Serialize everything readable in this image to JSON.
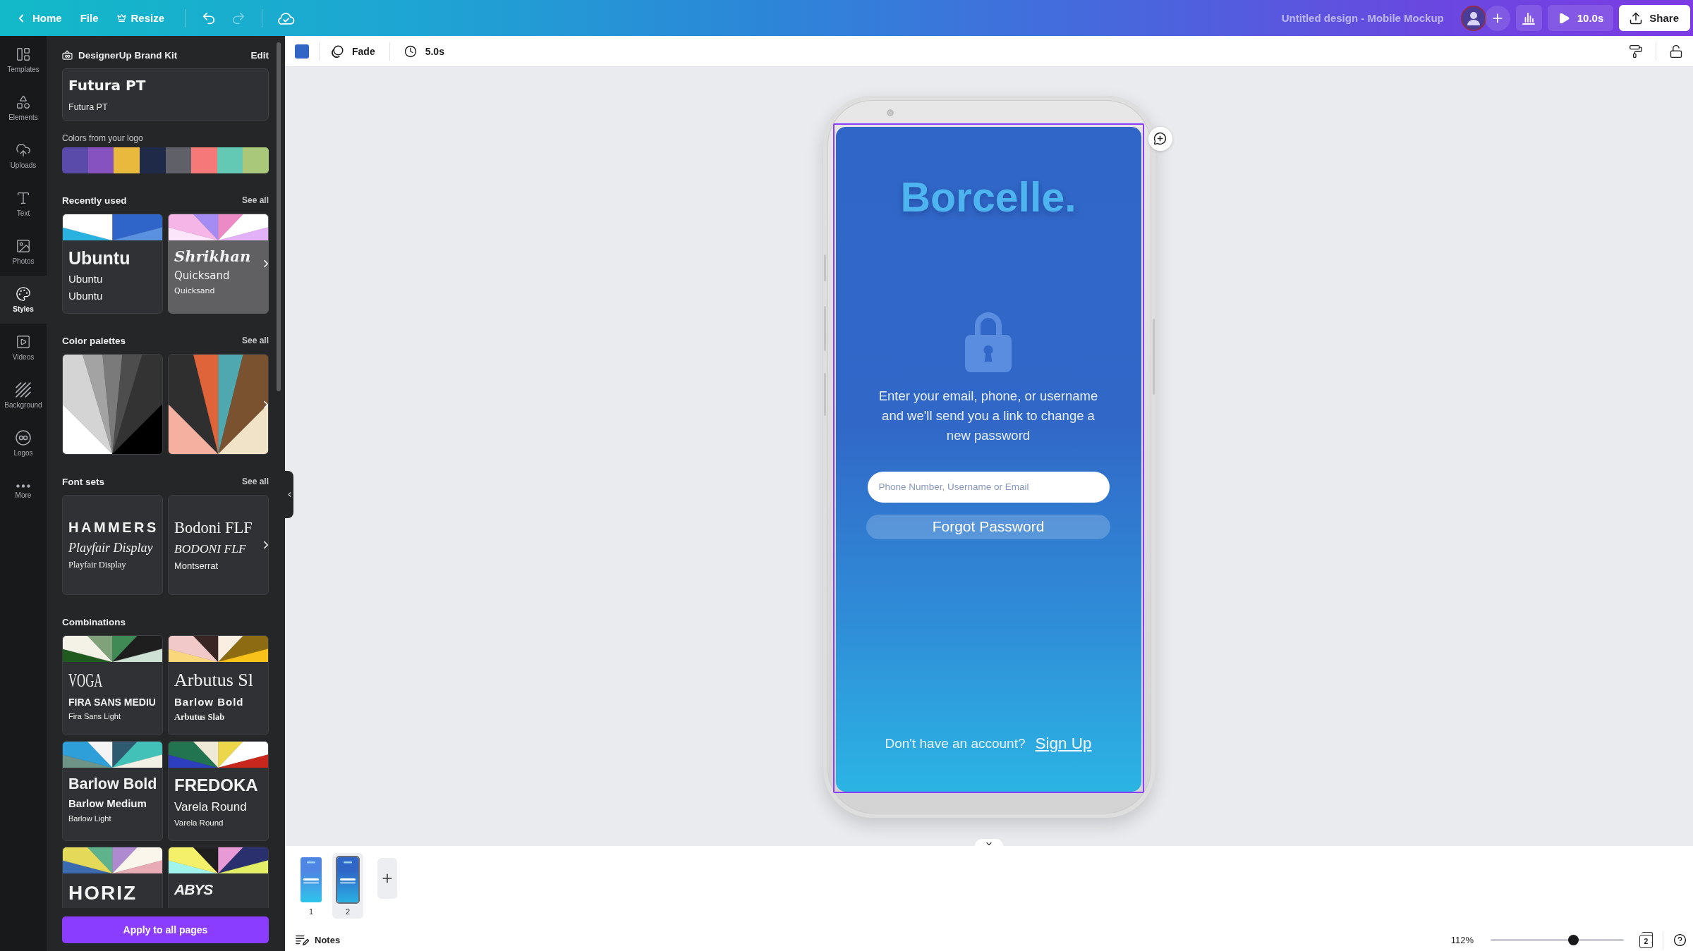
{
  "top_bar": {
    "home": "Home",
    "file": "File",
    "resize": "Resize",
    "history": [
      {
        "kind": "undo",
        "disabled": false
      },
      {
        "kind": "redo",
        "disabled": true
      }
    ],
    "title": "Untitled design - Mobile Mockup",
    "play": "10.0s",
    "share": "Share"
  },
  "rail": [
    {
      "kind": "templates",
      "label": "Templates",
      "selected": false
    },
    {
      "kind": "elements",
      "label": "Elements",
      "selected": false
    },
    {
      "kind": "uploads",
      "label": "Uploads",
      "selected": false
    },
    {
      "kind": "text",
      "label": "Text",
      "selected": false
    },
    {
      "kind": "photos",
      "label": "Photos",
      "selected": false
    },
    {
      "kind": "styles",
      "label": "Styles",
      "selected": true
    },
    {
      "kind": "videos",
      "label": "Videos",
      "selected": false
    },
    {
      "kind": "background",
      "label": "Background",
      "selected": false
    },
    {
      "kind": "logos",
      "label": "Logos",
      "selected": false
    },
    {
      "kind": "more",
      "label": "More",
      "selected": false
    }
  ],
  "panel": {
    "brand_kit": {
      "title": "DesignerUp Brand Kit",
      "edit": "Edit",
      "font_heading": "Futura PT",
      "font_body": "Futura PT",
      "colors_label": "Colors from your logo",
      "colors": [
        {
          "color": "#5a4baa"
        },
        {
          "color": "#8652c0"
        },
        {
          "color": "#e8b93c"
        },
        {
          "color": "#1e2a48"
        },
        {
          "color": "#5f6068"
        },
        {
          "color": "#f67878"
        },
        {
          "color": "#63c9b4"
        },
        {
          "color": "#a9c87a"
        }
      ]
    },
    "sections": [
      {
        "kind": "styles",
        "title": "Recently used",
        "see_all": "See all",
        "cards": [
          {
            "hovered": false,
            "palette": [
              {
                "color": "#29b1e0"
              },
              {
                "color": "#ffffff"
              },
              {
                "color": "#2f65c8"
              },
              {
                "color": "#5a91e0"
              }
            ],
            "lines": [
              "Ubuntu",
              "Ubuntu",
              "Ubuntu"
            ]
          },
          {
            "hovered": true,
            "palette": [
              {
                "color": "#fbe5fb"
              },
              {
                "color": "#f5b5e6"
              },
              {
                "color": "#a58cf5"
              },
              {
                "color": "#eb8ac4"
              },
              {
                "color": "#ffffff"
              },
              {
                "color": "#e3b1f7"
              }
            ],
            "lines": [
              "Shrikhan",
              "Quicksand",
              "Quicksand"
            ]
          }
        ]
      },
      {
        "kind": "palettes",
        "title": "Color palettes",
        "see_all": "See all",
        "cards": [
          {
            "palette": [
              {
                "color": "#ffffff"
              },
              {
                "color": "#d4d4d4"
              },
              {
                "color": "#a3a3a3"
              },
              {
                "color": "#7a7a7a"
              },
              {
                "color": "#4d4d4d"
              },
              {
                "color": "#333333"
              },
              {
                "color": "#000000"
              }
            ]
          },
          {
            "palette": [
              {
                "color": "#f6b0a0"
              },
              {
                "color": "#2f2f2f"
              },
              {
                "color": "#e0643a"
              },
              {
                "color": "#4fa8b0"
              },
              {
                "color": "#7a5230"
              },
              {
                "color": "#f1e3c8"
              }
            ]
          }
        ]
      },
      {
        "kind": "fonts",
        "title": "Font sets",
        "see_all": "See all",
        "cards": [
          {
            "lines": [
              "HAMMERS",
              "Playfair Display",
              "Playfair Display"
            ]
          },
          {
            "lines": [
              "Bodoni FLF",
              "BODONI FLF",
              "Montserrat"
            ]
          }
        ]
      },
      {
        "kind": "combinations",
        "title": "Combinations",
        "cards": [
          {
            "palette": [
              {
                "color": "#1f5a1e"
              },
              {
                "color": "#f4f1e6"
              },
              {
                "color": "#7fa27a"
              },
              {
                "color": "#3f8a55"
              },
              {
                "color": "#1e1e1e"
              },
              {
                "color": "#cfe0d4"
              }
            ],
            "lines": [
              "VOGA",
              "FIRA SANS MEDIU",
              "Fira Sans Light"
            ]
          },
          {
            "palette": [
              {
                "color": "#f9d77a"
              },
              {
                "color": "#f2c9c9"
              },
              {
                "color": "#3a2525"
              },
              {
                "color": "#f8eee2"
              },
              {
                "color": "#8c6b12"
              },
              {
                "color": "#f9c21a"
              }
            ],
            "lines": [
              "Arbutus Sl",
              "Barlow Bold",
              "Arbutus Slab"
            ]
          },
          {
            "palette": [
              {
                "color": "#6e9488"
              },
              {
                "color": "#2e9fd9"
              },
              {
                "color": "#f4f4f4"
              },
              {
                "color": "#2f5b70"
              },
              {
                "color": "#42c1b8"
              },
              {
                "color": "#f2efe4"
              }
            ],
            "lines": [
              "Barlow Bold",
              "Barlow Medium",
              "Barlow Light"
            ]
          },
          {
            "palette": [
              {
                "color": "#2d3fbf"
              },
              {
                "color": "#22734f"
              },
              {
                "color": "#efe9d8"
              },
              {
                "color": "#ecd74a"
              },
              {
                "color": "#ffffff"
              },
              {
                "color": "#c8271d"
              }
            ],
            "lines": [
              "FREDOKA",
              "Varela Round",
              "Varela Round"
            ]
          },
          {
            "palette": [
              {
                "color": "#3a6ab0"
              },
              {
                "color": "#e5d95a"
              },
              {
                "color": "#5fb38c"
              },
              {
                "color": "#b08ad0"
              },
              {
                "color": "#fbf6ec"
              },
              {
                "color": "#e8aab5"
              }
            ],
            "lines": [
              "HORIZ"
            ]
          },
          {
            "palette": [
              {
                "color": "#9ff5ec"
              },
              {
                "color": "#f5f06a"
              },
              {
                "color": "#1f1f1f"
              },
              {
                "color": "#e89ad6"
              },
              {
                "color": "#2a2f6e"
              },
              {
                "color": "#e2ef66"
              }
            ],
            "lines": [
              "ABYS"
            ]
          }
        ]
      }
    ],
    "apply": "Apply to all pages"
  },
  "toolbar": {
    "color": "#3166c6",
    "transition": "Fade",
    "duration": "5.0s"
  },
  "design": {
    "selected": true,
    "brand": "Borcelle.",
    "message": "Enter your email, phone, or username\nand we'll send you a link to change a\nnew password",
    "input": {
      "placeholder": "Phone Number, Username or Email"
    },
    "button": "Forgot Password",
    "prompt": "Don't have an account?",
    "link": "Sign Up"
  },
  "pages": [
    {
      "label": "1",
      "selected": false
    },
    {
      "label": "2",
      "selected": true
    }
  ],
  "footer": {
    "notes": "Notes",
    "zoom": "112%",
    "level": 0.62,
    "page_count": "2"
  }
}
